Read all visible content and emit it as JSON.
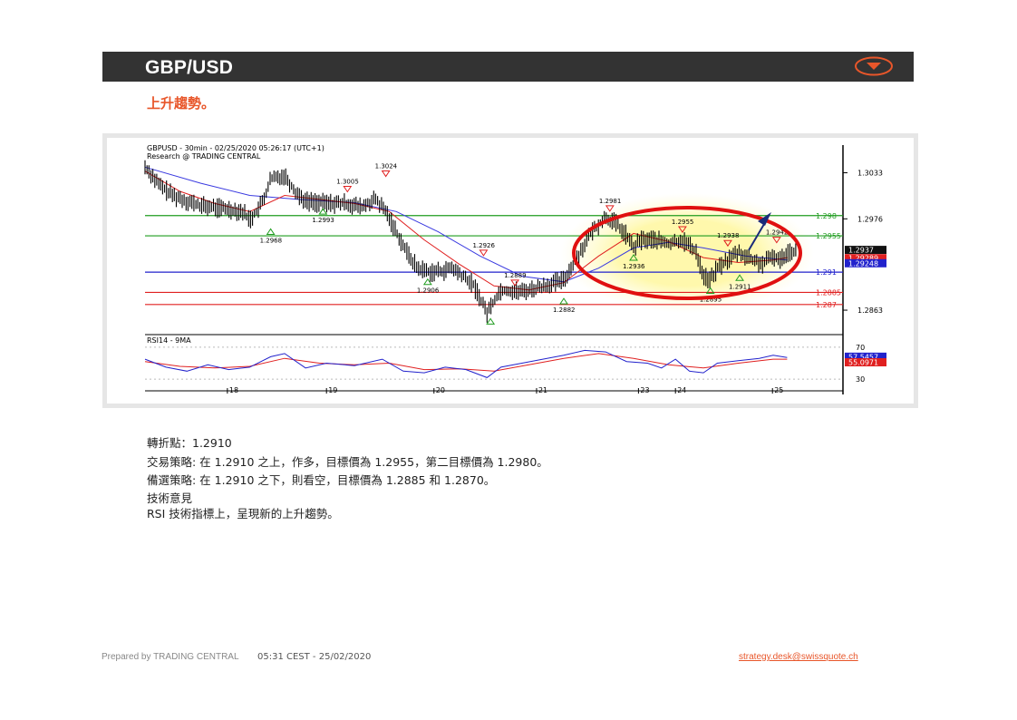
{
  "header": {
    "title": "GBP/USD"
  },
  "subtitle": "上升趨勢。",
  "chart_data": {
    "type": "line",
    "title_line1": "GBPUSD - 30min - 02/25/2020 05:26:17 (UTC+1)",
    "title_line2": "Research @ TRADING CENTRAL",
    "ylim": [
      1.2835,
      1.3065
    ],
    "y_ticks": [
      1.3033,
      1.2976,
      1.2863
    ],
    "x_tick_labels": [
      "18",
      "19",
      "20",
      "21",
      "23",
      "24",
      "25"
    ],
    "x_tick_pos": [
      0.118,
      0.26,
      0.414,
      0.561,
      0.707,
      0.76,
      0.899
    ],
    "price_path": [
      [
        0,
        1.304
      ],
      [
        0.01,
        1.303
      ],
      [
        0.02,
        1.3018
      ],
      [
        0.04,
        1.3005
      ],
      [
        0.06,
        1.2998
      ],
      [
        0.08,
        1.2992
      ],
      [
        0.1,
        1.299
      ],
      [
        0.12,
        1.2988
      ],
      [
        0.14,
        1.2985
      ],
      [
        0.15,
        1.2975
      ],
      [
        0.16,
        1.2985
      ],
      [
        0.17,
        1.3
      ],
      [
        0.18,
        1.3025
      ],
      [
        0.2,
        1.303
      ],
      [
        0.215,
        1.301
      ],
      [
        0.23,
        1.2998
      ],
      [
        0.26,
        1.2995
      ],
      [
        0.29,
        1.2995
      ],
      [
        0.31,
        1.299
      ],
      [
        0.33,
        1.3
      ],
      [
        0.345,
        1.2985
      ],
      [
        0.36,
        1.296
      ],
      [
        0.375,
        1.2935
      ],
      [
        0.39,
        1.2915
      ],
      [
        0.41,
        1.291
      ],
      [
        0.43,
        1.2912
      ],
      [
        0.44,
        1.2915
      ],
      [
        0.455,
        1.2905
      ],
      [
        0.47,
        1.2895
      ],
      [
        0.48,
        1.2878
      ],
      [
        0.49,
        1.286
      ],
      [
        0.5,
        1.2875
      ],
      [
        0.51,
        1.2888
      ],
      [
        0.54,
        1.2886
      ],
      [
        0.56,
        1.289
      ],
      [
        0.58,
        1.2895
      ],
      [
        0.6,
        1.29
      ],
      [
        0.62,
        1.293
      ],
      [
        0.64,
        1.296
      ],
      [
        0.66,
        1.2978
      ],
      [
        0.675,
        1.297
      ],
      [
        0.69,
        1.2955
      ],
      [
        0.7,
        1.294
      ],
      [
        0.71,
        1.295
      ],
      [
        0.73,
        1.295
      ],
      [
        0.75,
        1.2945
      ],
      [
        0.77,
        1.295
      ],
      [
        0.79,
        1.2935
      ],
      [
        0.8,
        1.2905
      ],
      [
        0.81,
        1.29
      ],
      [
        0.82,
        1.2915
      ],
      [
        0.835,
        1.2925
      ],
      [
        0.85,
        1.2935
      ],
      [
        0.87,
        1.2925
      ],
      [
        0.885,
        1.292
      ],
      [
        0.9,
        1.293
      ],
      [
        0.91,
        1.2925
      ],
      [
        0.92,
        1.2935
      ],
      [
        0.935,
        1.2937
      ]
    ],
    "ma_fast": [
      [
        0,
        1.3035
      ],
      [
        0.05,
        1.301
      ],
      [
        0.1,
        1.2995
      ],
      [
        0.15,
        1.2985
      ],
      [
        0.2,
        1.3005
      ],
      [
        0.25,
        1.3
      ],
      [
        0.3,
        1.2995
      ],
      [
        0.35,
        1.2985
      ],
      [
        0.4,
        1.295
      ],
      [
        0.45,
        1.292
      ],
      [
        0.5,
        1.2893
      ],
      [
        0.55,
        1.2888
      ],
      [
        0.6,
        1.2897
      ],
      [
        0.65,
        1.293
      ],
      [
        0.7,
        1.2958
      ],
      [
        0.75,
        1.2948
      ],
      [
        0.8,
        1.2928
      ],
      [
        0.85,
        1.2922
      ],
      [
        0.9,
        1.2925
      ],
      [
        0.92,
        1.2928
      ]
    ],
    "ma_slow": [
      [
        0,
        1.304
      ],
      [
        0.08,
        1.302
      ],
      [
        0.15,
        1.3005
      ],
      [
        0.22,
        1.3
      ],
      [
        0.3,
        1.2996
      ],
      [
        0.36,
        1.2985
      ],
      [
        0.42,
        1.296
      ],
      [
        0.48,
        1.293
      ],
      [
        0.54,
        1.2905
      ],
      [
        0.6,
        1.2898
      ],
      [
        0.65,
        1.2915
      ],
      [
        0.7,
        1.294
      ],
      [
        0.75,
        1.2947
      ],
      [
        0.8,
        1.294
      ],
      [
        0.86,
        1.293
      ],
      [
        0.92,
        1.2925
      ]
    ],
    "levels": [
      {
        "value": 1.298,
        "label": "1.298",
        "color": "#1f9c1f"
      },
      {
        "value": 1.2955,
        "label": "1.2955",
        "color": "#1f9c1f"
      },
      {
        "value": 1.291,
        "label": "1.291",
        "color": "#2222cc"
      },
      {
        "value": 1.2885,
        "label": "1.2885",
        "color": "#e02020"
      },
      {
        "value": 1.287,
        "label": "1.287",
        "color": "#e02020"
      }
    ],
    "annotations": [
      {
        "x": 0.345,
        "y": 1.3024,
        "label": "1.3024",
        "kind": "high"
      },
      {
        "x": 0.29,
        "y": 1.3005,
        "label": "1.3005",
        "kind": "high"
      },
      {
        "x": 0.255,
        "y": 1.2993,
        "label": "1.2993",
        "kind": "low"
      },
      {
        "x": 0.18,
        "y": 1.2968,
        "label": "1.2968",
        "kind": "low"
      },
      {
        "x": 0.405,
        "y": 1.2906,
        "label": "1.2906",
        "kind": "low"
      },
      {
        "x": 0.485,
        "y": 1.2926,
        "label": "1.2926",
        "kind": "high"
      },
      {
        "x": 0.53,
        "y": 1.2889,
        "label": "1.2889",
        "kind": "high"
      },
      {
        "x": 0.495,
        "y": 1.2857,
        "label": "",
        "kind": "low"
      },
      {
        "x": 0.6,
        "y": 1.2882,
        "label": "1.2882",
        "kind": "low"
      },
      {
        "x": 0.666,
        "y": 1.2981,
        "label": "1.2981",
        "kind": "high"
      },
      {
        "x": 0.7,
        "y": 1.2936,
        "label": "1.2936",
        "kind": "low"
      },
      {
        "x": 0.77,
        "y": 1.2955,
        "label": "1.2955",
        "kind": "high"
      },
      {
        "x": 0.81,
        "y": 1.2895,
        "label": "1.2895",
        "kind": "low"
      },
      {
        "x": 0.835,
        "y": 1.2938,
        "label": "1.2938",
        "kind": "high"
      },
      {
        "x": 0.852,
        "y": 1.2911,
        "label": "1.2911",
        "kind": "low"
      },
      {
        "x": 0.905,
        "y": 1.2942,
        "label": "1.2942",
        "kind": "high"
      }
    ],
    "current_labels": [
      {
        "value": 1.2937,
        "label": "1.2937",
        "bg": "#111111",
        "fg": "#ffffff"
      },
      {
        "value": 1.2929,
        "label": "1.29289",
        "bg": "#e02020",
        "fg": "#ffffff"
      },
      {
        "value": 1.2925,
        "label": "1.29248",
        "bg": "#2222cc",
        "fg": "#ffffff"
      }
    ],
    "rsi": {
      "label": "RSI14 - 9MA",
      "ylim": [
        20,
        80
      ],
      "y_ticks": [
        70,
        30
      ],
      "current": [
        {
          "label": "57.5457",
          "bg": "#2222cc",
          "value": 57.5
        },
        {
          "label": "55.0971",
          "bg": "#e02020",
          "value": 55.1
        }
      ],
      "rsi_path": [
        [
          0,
          55
        ],
        [
          0.03,
          45
        ],
        [
          0.06,
          40
        ],
        [
          0.09,
          48
        ],
        [
          0.12,
          42
        ],
        [
          0.15,
          45
        ],
        [
          0.18,
          58
        ],
        [
          0.2,
          62
        ],
        [
          0.23,
          44
        ],
        [
          0.26,
          50
        ],
        [
          0.3,
          47
        ],
        [
          0.34,
          55
        ],
        [
          0.37,
          40
        ],
        [
          0.4,
          38
        ],
        [
          0.43,
          45
        ],
        [
          0.46,
          42
        ],
        [
          0.49,
          32
        ],
        [
          0.51,
          45
        ],
        [
          0.54,
          50
        ],
        [
          0.57,
          55
        ],
        [
          0.6,
          60
        ],
        [
          0.63,
          66
        ],
        [
          0.66,
          64
        ],
        [
          0.69,
          52
        ],
        [
          0.72,
          50
        ],
        [
          0.74,
          44
        ],
        [
          0.76,
          55
        ],
        [
          0.78,
          40
        ],
        [
          0.8,
          38
        ],
        [
          0.82,
          50
        ],
        [
          0.85,
          53
        ],
        [
          0.88,
          56
        ],
        [
          0.9,
          60
        ],
        [
          0.92,
          57
        ]
      ],
      "ma_path": [
        [
          0,
          52
        ],
        [
          0.05,
          46
        ],
        [
          0.1,
          44
        ],
        [
          0.15,
          46
        ],
        [
          0.2,
          56
        ],
        [
          0.25,
          50
        ],
        [
          0.3,
          48
        ],
        [
          0.35,
          50
        ],
        [
          0.4,
          42
        ],
        [
          0.45,
          43
        ],
        [
          0.5,
          40
        ],
        [
          0.55,
          48
        ],
        [
          0.6,
          56
        ],
        [
          0.65,
          62
        ],
        [
          0.7,
          56
        ],
        [
          0.75,
          48
        ],
        [
          0.8,
          44
        ],
        [
          0.85,
          50
        ],
        [
          0.9,
          55
        ],
        [
          0.92,
          55
        ]
      ]
    }
  },
  "notes": {
    "pivot": "轉折點：1.2910",
    "strategy": "交易策略: 在 1.2910 之上，作多，目標價為  1.2955，第二目標價為  1.2980。",
    "alternative": "備選策略: 在 1.2910 之下，則看空，目標價為  1.2885 和 1.2870。",
    "comment_title": "技術意見",
    "comment": "RSI 技術指標上，呈現新的上升趨勢。"
  },
  "footer": {
    "prepared": "Prepared by TRADING CENTRAL",
    "timestamp": "05:31 CEST - 25/02/2020",
    "email": "strategy.desk@swissquote.ch"
  },
  "colors": {
    "accent": "#e8562a",
    "header_bg": "#333333"
  }
}
